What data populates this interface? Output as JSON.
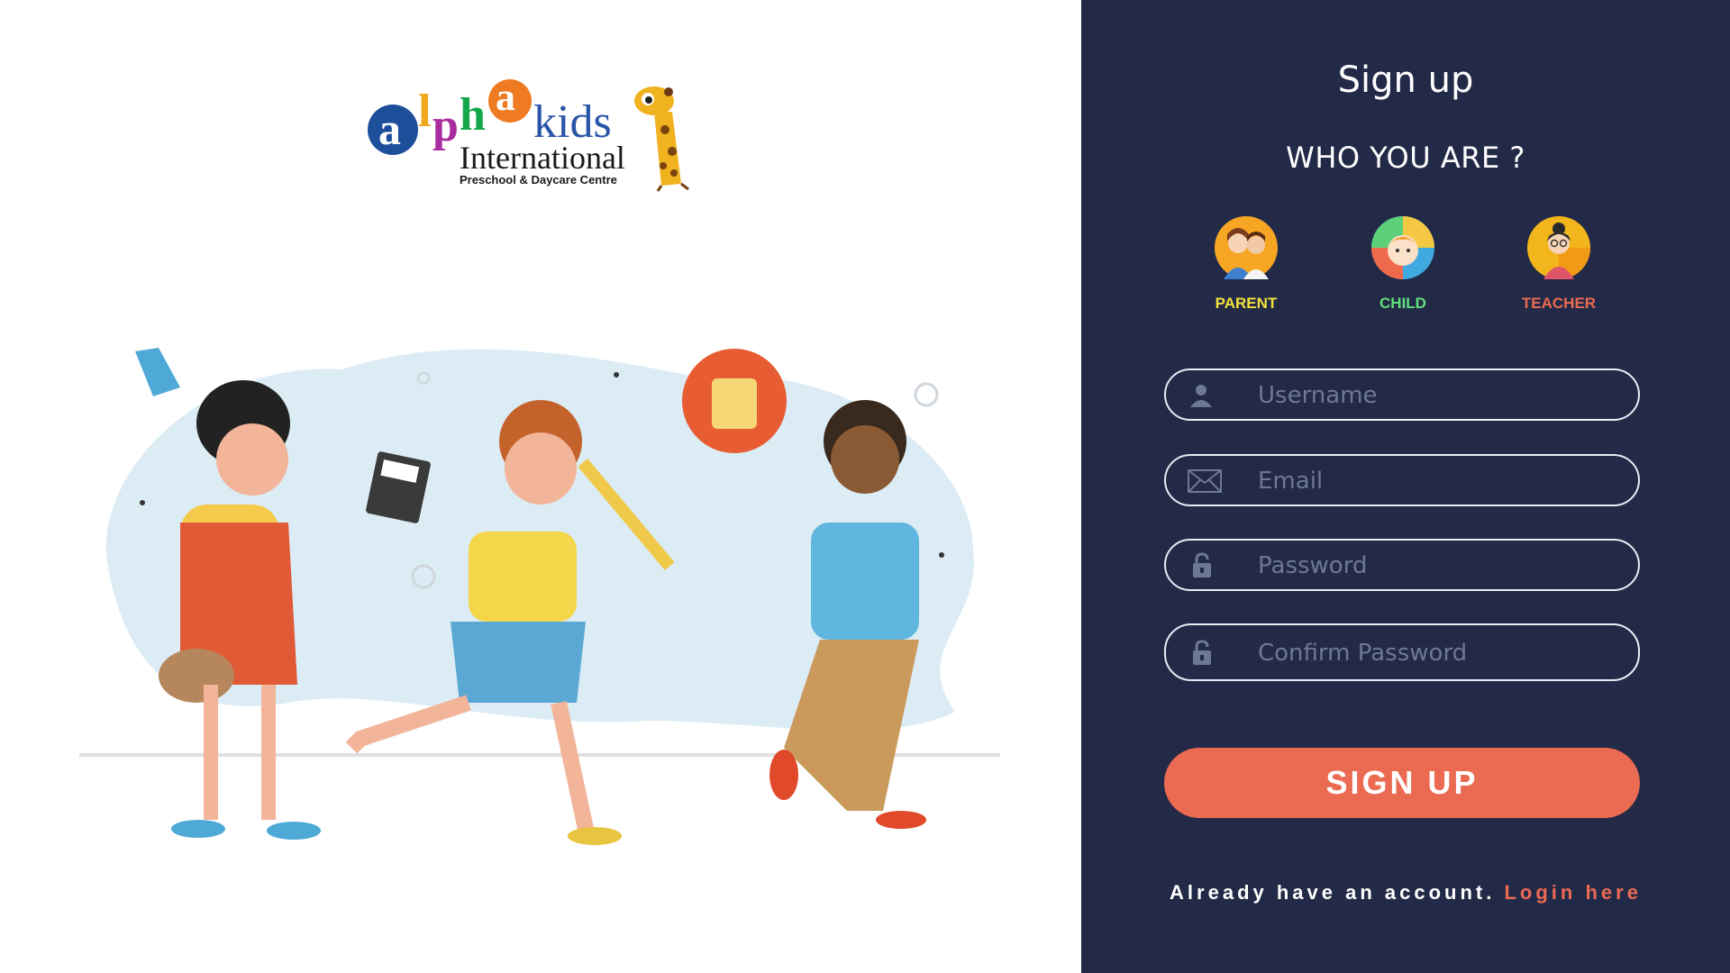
{
  "brand": {
    "logo_letters": [
      "a",
      "l",
      "p",
      "h",
      "a",
      "kids"
    ],
    "line2": "International",
    "line3": "Preschool & Daycare Centre"
  },
  "form": {
    "title": "Sign up",
    "question": "WHO YOU ARE ?",
    "roles": [
      {
        "label": "PARENT",
        "color": "#f2e23b"
      },
      {
        "label": "CHILD",
        "color": "#5fe07c"
      },
      {
        "label": "TEACHER",
        "color": "#ea6a52"
      }
    ],
    "fields": {
      "username": {
        "placeholder": "Username",
        "value": ""
      },
      "email": {
        "placeholder": "Email",
        "value": ""
      },
      "password": {
        "placeholder": "Password",
        "value": ""
      },
      "confirm": {
        "placeholder": "Confirm Password",
        "value": ""
      }
    },
    "submit_label": "SIGN UP",
    "login_prompt": "Already have an account. ",
    "login_link": "Login here"
  },
  "colors": {
    "panel_bg": "#232a47",
    "accent": "#ea6a52",
    "field_border": "#e9ecf5"
  },
  "icons": [
    "user-icon",
    "envelope-icon",
    "lock-icon",
    "lock-icon"
  ]
}
